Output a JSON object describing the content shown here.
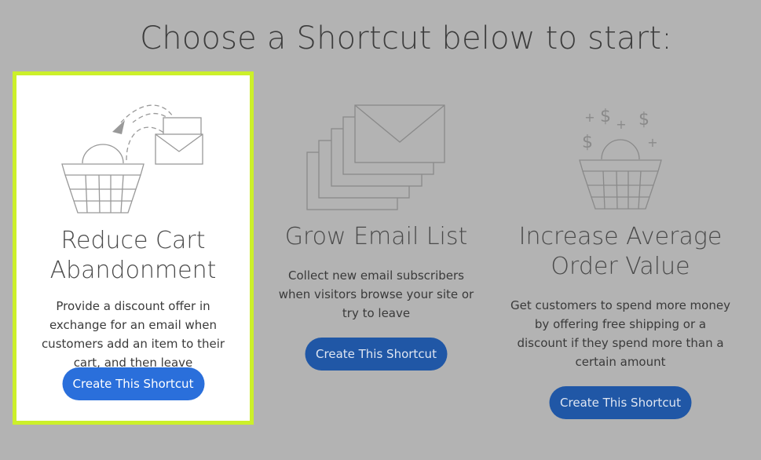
{
  "heading": "Choose a Shortcut below to start:",
  "cards": [
    {
      "title_line1": "Reduce Cart",
      "title_line2": "Abandonment",
      "description": "Provide a discount offer in exchange for an email when customers add an item to their cart, and then leave",
      "button_label": "Create This Shortcut",
      "icon": "cart-email-icon",
      "selected": true
    },
    {
      "title_line1": "Grow Email List",
      "title_line2": "",
      "description": "Collect new email subscribers when visitors browse your site or try to leave",
      "button_label": "Create This Shortcut",
      "icon": "stacked-envelopes-icon",
      "selected": false
    },
    {
      "title_line1": "Increase Average",
      "title_line2": "Order Value",
      "description": "Get customers to spend more money by offering free shipping or a discount if they spend more than a certain amount",
      "button_label": "Create This Shortcut",
      "icon": "cart-dollars-icon",
      "selected": false
    }
  ],
  "colors": {
    "background": "#b3b3b3",
    "selected_border": "#ccf02a",
    "button_primary": "#2a6fdb",
    "button_muted": "#2057a6"
  }
}
